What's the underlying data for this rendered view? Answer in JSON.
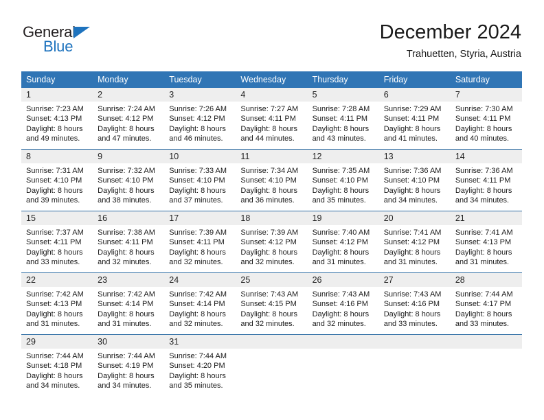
{
  "brand": {
    "name_part1": "General",
    "name_part2": "Blue",
    "accent_color": "#1e73be"
  },
  "header": {
    "title": "December 2024",
    "subtitle": "Trahuetten, Styria, Austria"
  },
  "calendar": {
    "header_bg": "#3075b5",
    "daynum_bg": "#eeeeee",
    "weekday_headers": [
      "Sunday",
      "Monday",
      "Tuesday",
      "Wednesday",
      "Thursday",
      "Friday",
      "Saturday"
    ],
    "weeks": [
      [
        {
          "day": "1",
          "sunrise": "Sunrise: 7:23 AM",
          "sunset": "Sunset: 4:13 PM",
          "daylight1": "Daylight: 8 hours",
          "daylight2": "and 49 minutes."
        },
        {
          "day": "2",
          "sunrise": "Sunrise: 7:24 AM",
          "sunset": "Sunset: 4:12 PM",
          "daylight1": "Daylight: 8 hours",
          "daylight2": "and 47 minutes."
        },
        {
          "day": "3",
          "sunrise": "Sunrise: 7:26 AM",
          "sunset": "Sunset: 4:12 PM",
          "daylight1": "Daylight: 8 hours",
          "daylight2": "and 46 minutes."
        },
        {
          "day": "4",
          "sunrise": "Sunrise: 7:27 AM",
          "sunset": "Sunset: 4:11 PM",
          "daylight1": "Daylight: 8 hours",
          "daylight2": "and 44 minutes."
        },
        {
          "day": "5",
          "sunrise": "Sunrise: 7:28 AM",
          "sunset": "Sunset: 4:11 PM",
          "daylight1": "Daylight: 8 hours",
          "daylight2": "and 43 minutes."
        },
        {
          "day": "6",
          "sunrise": "Sunrise: 7:29 AM",
          "sunset": "Sunset: 4:11 PM",
          "daylight1": "Daylight: 8 hours",
          "daylight2": "and 41 minutes."
        },
        {
          "day": "7",
          "sunrise": "Sunrise: 7:30 AM",
          "sunset": "Sunset: 4:11 PM",
          "daylight1": "Daylight: 8 hours",
          "daylight2": "and 40 minutes."
        }
      ],
      [
        {
          "day": "8",
          "sunrise": "Sunrise: 7:31 AM",
          "sunset": "Sunset: 4:10 PM",
          "daylight1": "Daylight: 8 hours",
          "daylight2": "and 39 minutes."
        },
        {
          "day": "9",
          "sunrise": "Sunrise: 7:32 AM",
          "sunset": "Sunset: 4:10 PM",
          "daylight1": "Daylight: 8 hours",
          "daylight2": "and 38 minutes."
        },
        {
          "day": "10",
          "sunrise": "Sunrise: 7:33 AM",
          "sunset": "Sunset: 4:10 PM",
          "daylight1": "Daylight: 8 hours",
          "daylight2": "and 37 minutes."
        },
        {
          "day": "11",
          "sunrise": "Sunrise: 7:34 AM",
          "sunset": "Sunset: 4:10 PM",
          "daylight1": "Daylight: 8 hours",
          "daylight2": "and 36 minutes."
        },
        {
          "day": "12",
          "sunrise": "Sunrise: 7:35 AM",
          "sunset": "Sunset: 4:10 PM",
          "daylight1": "Daylight: 8 hours",
          "daylight2": "and 35 minutes."
        },
        {
          "day": "13",
          "sunrise": "Sunrise: 7:36 AM",
          "sunset": "Sunset: 4:10 PM",
          "daylight1": "Daylight: 8 hours",
          "daylight2": "and 34 minutes."
        },
        {
          "day": "14",
          "sunrise": "Sunrise: 7:36 AM",
          "sunset": "Sunset: 4:11 PM",
          "daylight1": "Daylight: 8 hours",
          "daylight2": "and 34 minutes."
        }
      ],
      [
        {
          "day": "15",
          "sunrise": "Sunrise: 7:37 AM",
          "sunset": "Sunset: 4:11 PM",
          "daylight1": "Daylight: 8 hours",
          "daylight2": "and 33 minutes."
        },
        {
          "day": "16",
          "sunrise": "Sunrise: 7:38 AM",
          "sunset": "Sunset: 4:11 PM",
          "daylight1": "Daylight: 8 hours",
          "daylight2": "and 32 minutes."
        },
        {
          "day": "17",
          "sunrise": "Sunrise: 7:39 AM",
          "sunset": "Sunset: 4:11 PM",
          "daylight1": "Daylight: 8 hours",
          "daylight2": "and 32 minutes."
        },
        {
          "day": "18",
          "sunrise": "Sunrise: 7:39 AM",
          "sunset": "Sunset: 4:12 PM",
          "daylight1": "Daylight: 8 hours",
          "daylight2": "and 32 minutes."
        },
        {
          "day": "19",
          "sunrise": "Sunrise: 7:40 AM",
          "sunset": "Sunset: 4:12 PM",
          "daylight1": "Daylight: 8 hours",
          "daylight2": "and 31 minutes."
        },
        {
          "day": "20",
          "sunrise": "Sunrise: 7:41 AM",
          "sunset": "Sunset: 4:12 PM",
          "daylight1": "Daylight: 8 hours",
          "daylight2": "and 31 minutes."
        },
        {
          "day": "21",
          "sunrise": "Sunrise: 7:41 AM",
          "sunset": "Sunset: 4:13 PM",
          "daylight1": "Daylight: 8 hours",
          "daylight2": "and 31 minutes."
        }
      ],
      [
        {
          "day": "22",
          "sunrise": "Sunrise: 7:42 AM",
          "sunset": "Sunset: 4:13 PM",
          "daylight1": "Daylight: 8 hours",
          "daylight2": "and 31 minutes."
        },
        {
          "day": "23",
          "sunrise": "Sunrise: 7:42 AM",
          "sunset": "Sunset: 4:14 PM",
          "daylight1": "Daylight: 8 hours",
          "daylight2": "and 31 minutes."
        },
        {
          "day": "24",
          "sunrise": "Sunrise: 7:42 AM",
          "sunset": "Sunset: 4:14 PM",
          "daylight1": "Daylight: 8 hours",
          "daylight2": "and 32 minutes."
        },
        {
          "day": "25",
          "sunrise": "Sunrise: 7:43 AM",
          "sunset": "Sunset: 4:15 PM",
          "daylight1": "Daylight: 8 hours",
          "daylight2": "and 32 minutes."
        },
        {
          "day": "26",
          "sunrise": "Sunrise: 7:43 AM",
          "sunset": "Sunset: 4:16 PM",
          "daylight1": "Daylight: 8 hours",
          "daylight2": "and 32 minutes."
        },
        {
          "day": "27",
          "sunrise": "Sunrise: 7:43 AM",
          "sunset": "Sunset: 4:16 PM",
          "daylight1": "Daylight: 8 hours",
          "daylight2": "and 33 minutes."
        },
        {
          "day": "28",
          "sunrise": "Sunrise: 7:44 AM",
          "sunset": "Sunset: 4:17 PM",
          "daylight1": "Daylight: 8 hours",
          "daylight2": "and 33 minutes."
        }
      ],
      [
        {
          "day": "29",
          "sunrise": "Sunrise: 7:44 AM",
          "sunset": "Sunset: 4:18 PM",
          "daylight1": "Daylight: 8 hours",
          "daylight2": "and 34 minutes."
        },
        {
          "day": "30",
          "sunrise": "Sunrise: 7:44 AM",
          "sunset": "Sunset: 4:19 PM",
          "daylight1": "Daylight: 8 hours",
          "daylight2": "and 34 minutes."
        },
        {
          "day": "31",
          "sunrise": "Sunrise: 7:44 AM",
          "sunset": "Sunset: 4:20 PM",
          "daylight1": "Daylight: 8 hours",
          "daylight2": "and 35 minutes."
        },
        {
          "day": "",
          "sunrise": "",
          "sunset": "",
          "daylight1": "",
          "daylight2": ""
        },
        {
          "day": "",
          "sunrise": "",
          "sunset": "",
          "daylight1": "",
          "daylight2": ""
        },
        {
          "day": "",
          "sunrise": "",
          "sunset": "",
          "daylight1": "",
          "daylight2": ""
        },
        {
          "day": "",
          "sunrise": "",
          "sunset": "",
          "daylight1": "",
          "daylight2": ""
        }
      ]
    ]
  }
}
